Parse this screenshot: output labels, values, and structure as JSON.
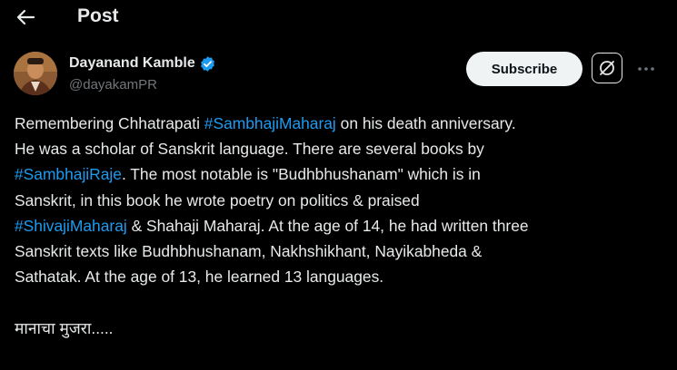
{
  "header": {
    "title": "Post"
  },
  "author": {
    "name": "Dayanand Kamble",
    "handle": "@dayakamPR",
    "verified_color": "#1d9bf0"
  },
  "actions": {
    "subscribe_label": "Subscribe"
  },
  "post": {
    "lines": [
      [
        {
          "t": "Remembering Chhatrapati "
        },
        {
          "t": "#SambhajiMaharaj",
          "tag": true
        },
        {
          "t": " on his death anniversary."
        }
      ],
      [
        {
          "t": "He was a scholar of Sanskrit language. There are several books by"
        }
      ],
      [
        {
          "t": "#SambhajiRaje",
          "tag": true
        },
        {
          "t": ". The most notable is \"Budhbhushanam\" which is in"
        }
      ],
      [
        {
          "t": "Sanskrit, in this book he wrote poetry on politics & praised"
        }
      ],
      [
        {
          "t": "#ShivajiMaharaj",
          "tag": true
        },
        {
          "t": " & Shahaji Maharaj. At the age of 14, he had written three"
        }
      ],
      [
        {
          "t": "Sanskrit texts like Budhbhushanam, Nakhshikhant, Nayikabheda &"
        }
      ],
      [
        {
          "t": "Sathatak. At the age of 13, he learned 13 languages."
        }
      ]
    ],
    "closing": "मानाचा मुजरा....."
  },
  "colors": {
    "hashtag": "#1d9bf0",
    "background": "#000000",
    "text": "#e7e9ea"
  }
}
